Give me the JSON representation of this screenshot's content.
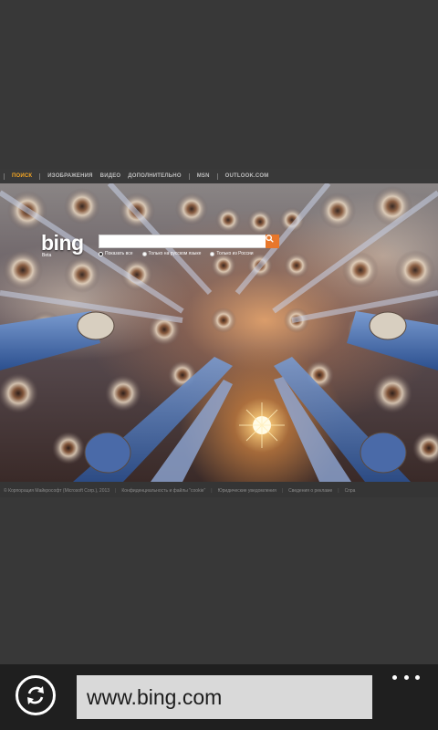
{
  "page": {
    "nav": {
      "items": [
        "ПОИСК",
        "ИЗОБРАЖЕНИЯ",
        "ВИДЕО",
        "ДОПОЛНИТЕЛЬНО",
        "MSN",
        "OUTLOOK.COM"
      ]
    },
    "logo_text": "bing",
    "logo_sub": "Beta",
    "search": {
      "value": "",
      "button_icon": "search-icon"
    },
    "radios": [
      {
        "label": "Показать все",
        "selected": true
      },
      {
        "label": "Только на русском языке",
        "selected": false
      },
      {
        "label": "Только из России",
        "selected": false
      }
    ],
    "footer": [
      "© Корпорация Майкрософт (Microsoft Corp.), 2013",
      "Конфиденциальность и файлы \"cookie\"",
      "Юридические уведомления",
      "Сведения о рекламе",
      "Спра"
    ]
  },
  "browser": {
    "url": "www.bing.com",
    "refresh_icon": "refresh-icon",
    "more_icon": "more-dots-icon"
  },
  "colors": {
    "accent": "#f5a623",
    "search_button": "#e8772b",
    "appbar_bg": "#1f1f1f",
    "page_bg": "#383838"
  }
}
